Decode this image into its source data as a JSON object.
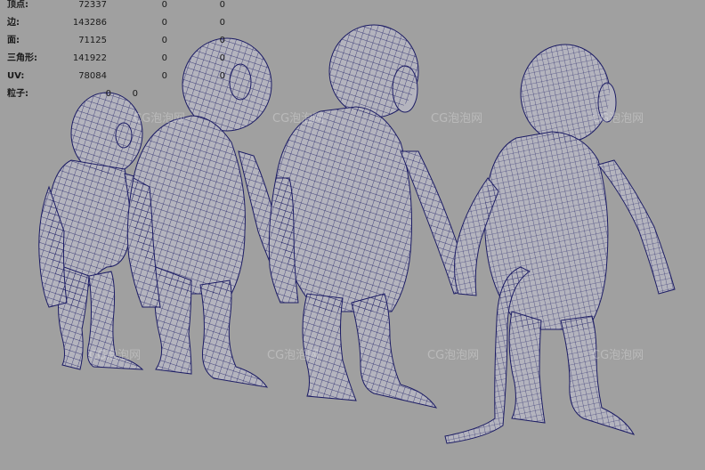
{
  "hud": {
    "rows": [
      {
        "label": "顶点:",
        "v1": "72337",
        "v2": "0",
        "v3": "0"
      },
      {
        "label": "边:",
        "v1": "143286",
        "v2": "0",
        "v3": "0"
      },
      {
        "label": "面:",
        "v1": "71125",
        "v2": "0",
        "v3": "0"
      },
      {
        "label": "三角形:",
        "v1": "141922",
        "v2": "0",
        "v3": "0"
      },
      {
        "label": "UV:",
        "v1": "78084",
        "v2": "0",
        "v3": "0"
      },
      {
        "label": "粒子:",
        "v1": "0",
        "v2": "0",
        "v3": ""
      }
    ]
  },
  "watermark": "CG泡泡网",
  "colors": {
    "viewport_bg": "#a0a0a0",
    "mesh_fill": "#b4b4be",
    "wireframe": "#1c1c64"
  },
  "icons": [
    "monkey-wireframe-model"
  ]
}
